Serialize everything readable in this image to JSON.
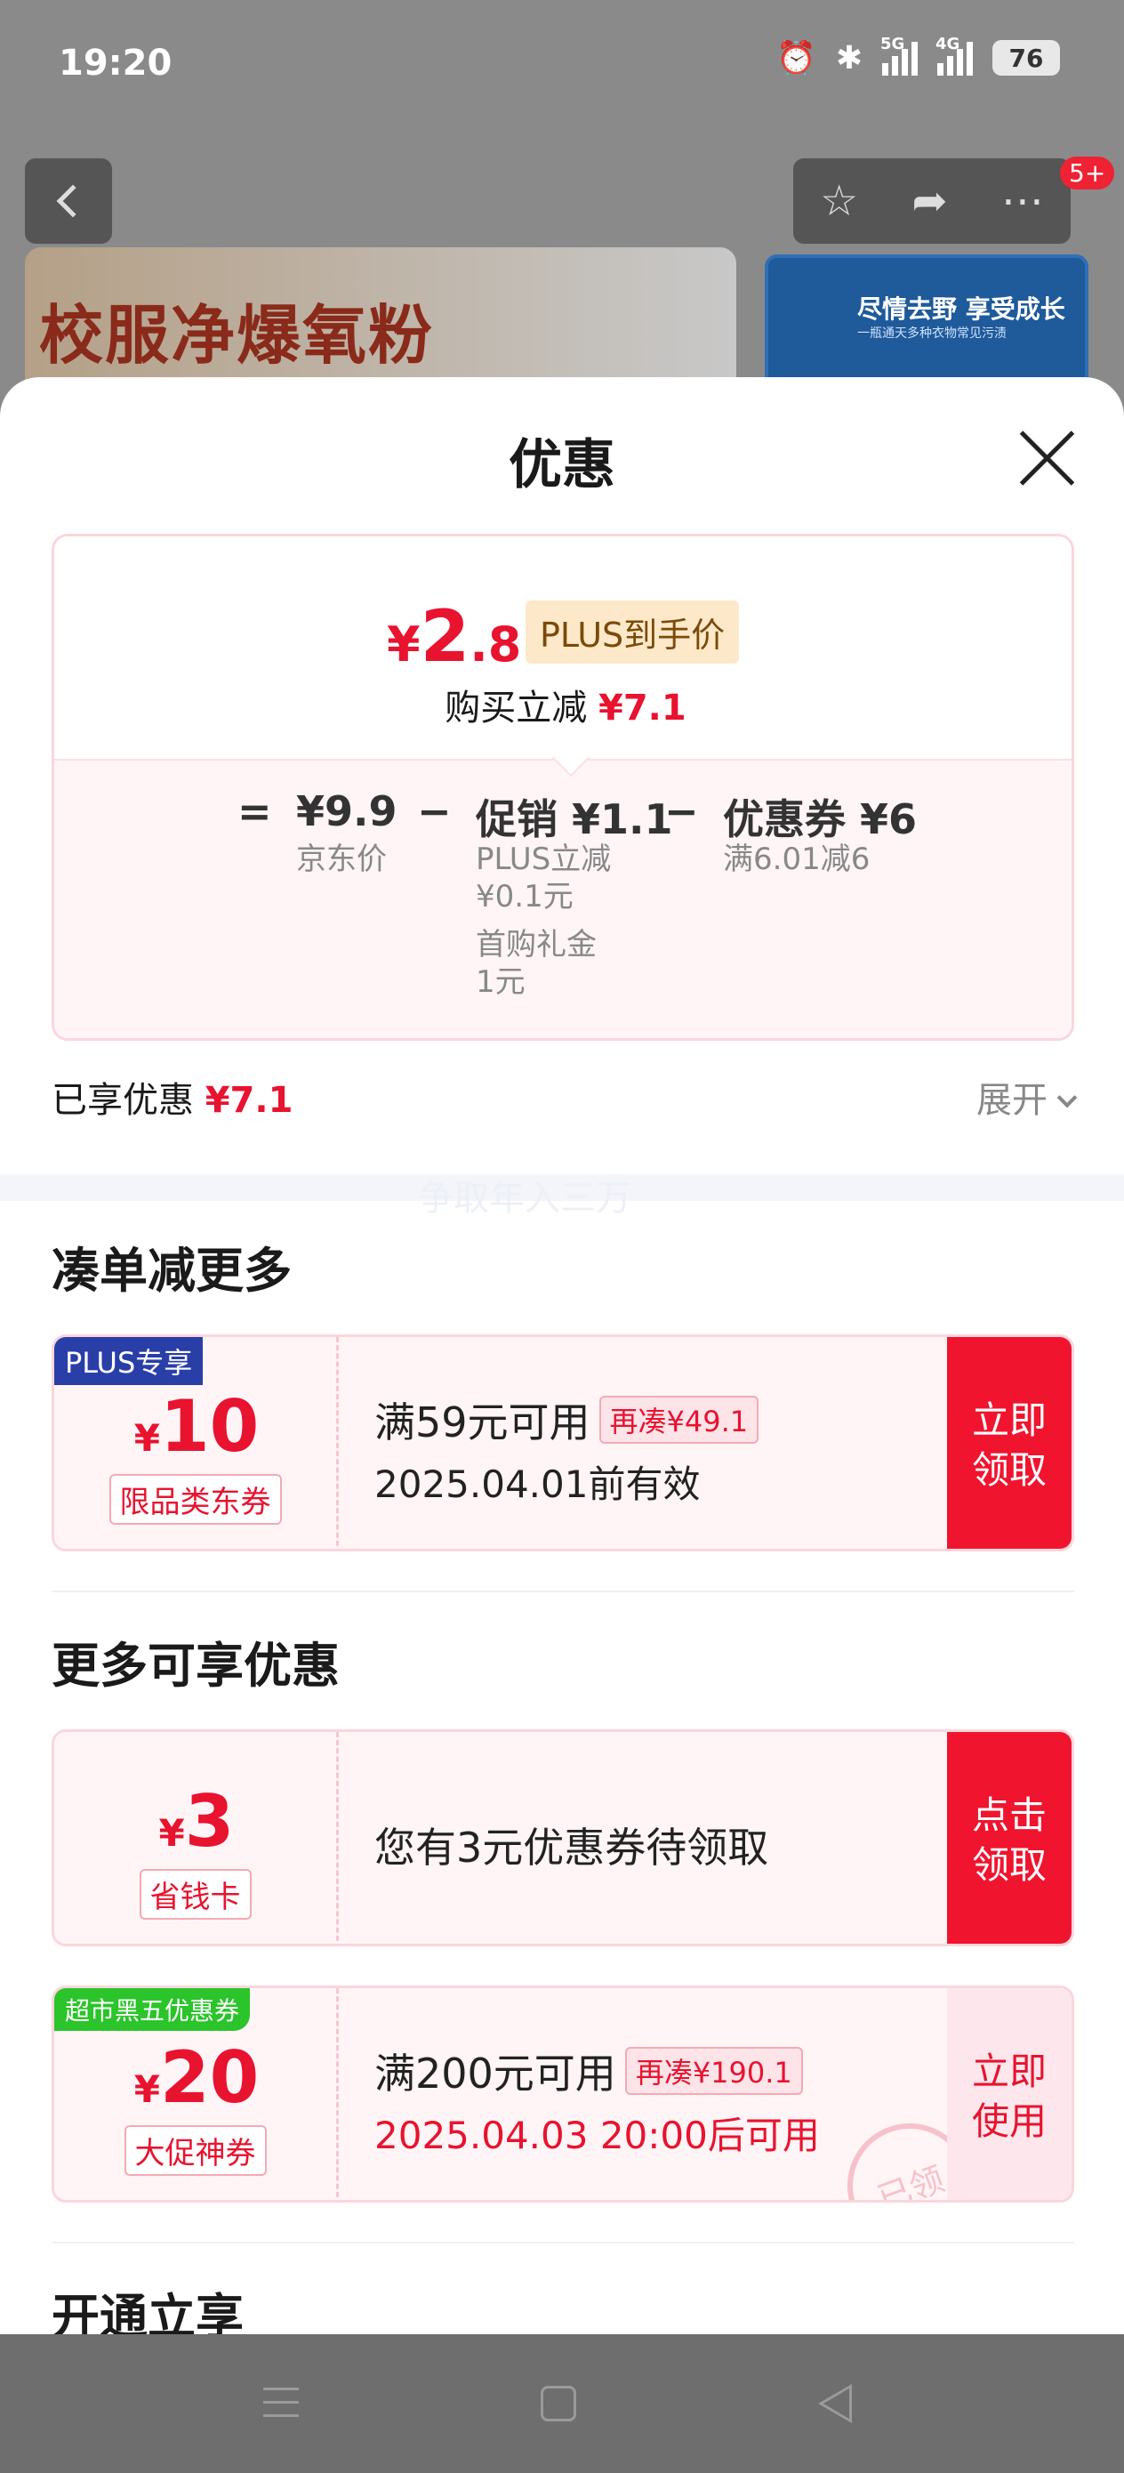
{
  "status_bar": {
    "time": "19:20",
    "battery": "76",
    "signal1_label": "5G",
    "signal2_label": "4G"
  },
  "background_page": {
    "badge": "5+",
    "banner_left_text": "校服净爆氧粉",
    "banner_right_text": "尽情去野 享受成长",
    "banner_right_sub": "一瓶通天多种衣物常见污渍"
  },
  "sheet": {
    "title": "优惠",
    "price_card": {
      "currency": "¥",
      "final_int": "2",
      "final_dec": ".8",
      "plus_tag": "PLUS到手价",
      "reduce_label": "购买立减",
      "reduce_value": "¥7.1",
      "equals": "=",
      "minus": "−",
      "jd_price": "¥9.9",
      "jd_price_label": "京东价",
      "promo": "促销 ¥1.1",
      "promo_sub1": "PLUS立减",
      "promo_sub2": "¥0.1元",
      "promo_sub3": "首购礼金",
      "promo_sub4": "1元",
      "coupon": "优惠券 ¥6",
      "coupon_sub": "满6.01减6"
    },
    "enjoyed_label": "已享优惠",
    "enjoyed_value": "¥7.1",
    "expand_label": "展开",
    "ghost_text": "争取年入三万",
    "section1_title": "凑单减更多",
    "coupon1": {
      "corner": "PLUS专享",
      "yen": "¥",
      "amount": "10",
      "type": "限品类东券",
      "condition": "满59元可用",
      "extra": "再凑¥49.1",
      "validity": "2025.04.01前有效",
      "action": "立即\n领取"
    },
    "section2_title": "更多可享优惠",
    "coupon2": {
      "yen": "¥",
      "amount": "3",
      "type": "省钱卡",
      "text": "您有3元优惠券待领取",
      "action": "点击\n领取"
    },
    "coupon3": {
      "corner": "超市黑五优惠券",
      "yen": "¥",
      "amount": "20",
      "type": "大促神券",
      "condition": "满200元可用",
      "extra": "再凑¥190.1",
      "validity": "2025.04.03 20:00后可用",
      "action": "立即\n使用",
      "stamp": "已领"
    },
    "section3_title": "开通立享"
  },
  "colors": {
    "accent": "#e8132f",
    "plus_tag_bg": "#fde9c9",
    "plus_blue": "#2a3ea8",
    "green_tag": "#2bc42b"
  }
}
